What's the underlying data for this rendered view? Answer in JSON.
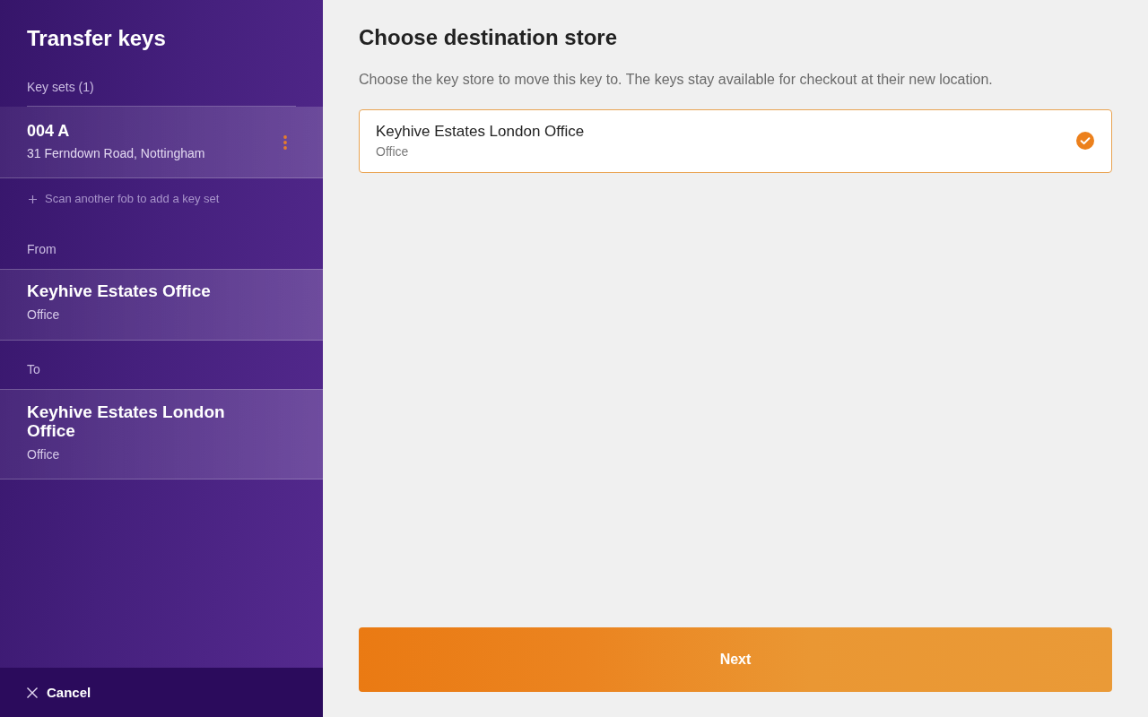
{
  "sidebar": {
    "title": "Transfer keys",
    "key_sets_label": "Key sets (1)",
    "key_sets": [
      {
        "code": "004 A",
        "address": "31 Ferndown Road, Nottingham"
      }
    ],
    "scan_hint": "Scan another fob to add a key set",
    "from": {
      "label": "From",
      "name": "Keyhive Estates Office",
      "type": "Office"
    },
    "to": {
      "label": "To",
      "name": "Keyhive Estates London Office",
      "type": "Office"
    },
    "cancel_button": "Cancel"
  },
  "main": {
    "title": "Choose destination store",
    "description": "Choose the key store to move this key to. The keys stay available for checkout at their new location.",
    "stores": [
      {
        "name": "Keyhive Estates London Office",
        "type": "Office",
        "selected": true
      }
    ],
    "next_button": "Next"
  }
}
